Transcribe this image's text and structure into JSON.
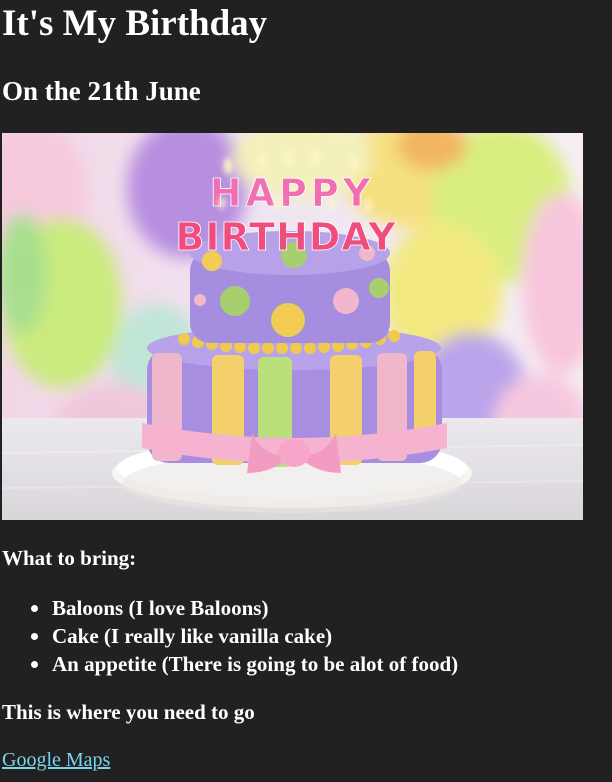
{
  "page": {
    "title": "It's My Birthday",
    "subtitle": "On the 21th June"
  },
  "image": {
    "topper_line1": "HAPPY",
    "topper_line2": "BIRTHDAY"
  },
  "bring": {
    "title": "What to bring:",
    "items": [
      "Baloons (I love Baloons)",
      "Cake (I really like vanilla cake)",
      "An appetite (There is going to be alot of food)"
    ]
  },
  "location": {
    "text": "This is where you need to go",
    "link_label": "Google Maps"
  },
  "colors": {
    "background": "#212121",
    "text": "#ffffff",
    "link": "#7ad4ef"
  }
}
